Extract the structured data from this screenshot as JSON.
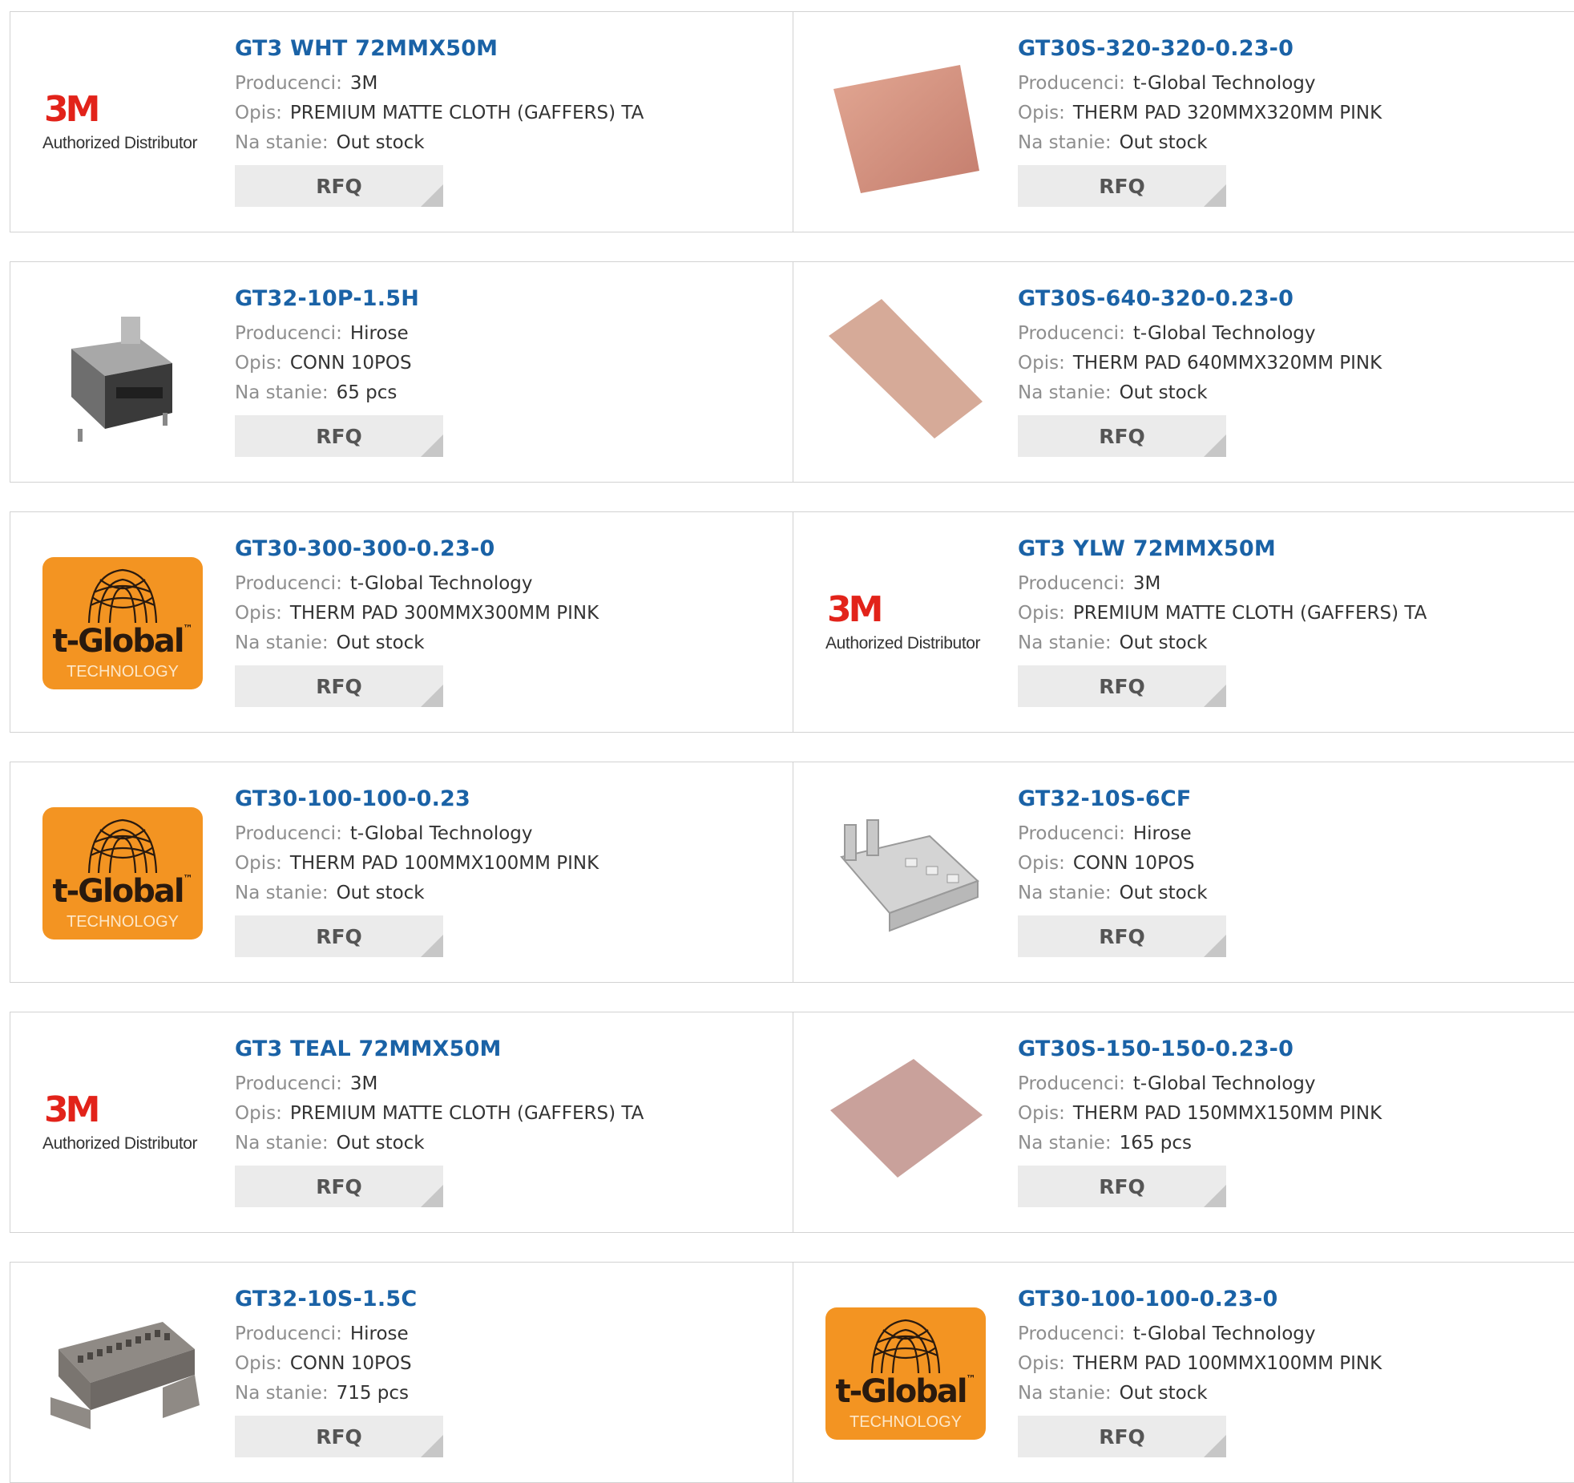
{
  "labels": {
    "manufacturer": "Producenci:",
    "description": "Opis:",
    "stock": "Na stanie:",
    "rfq": "RFQ"
  },
  "logos": {
    "three_m": {
      "mark": "3M",
      "sub": "Authorized Distributor"
    },
    "tglobal": {
      "word": "t-Global",
      "tm": "™",
      "tech": "TECHNOLOGY"
    }
  },
  "colors": {
    "link": "#1a62a6",
    "label": "#8e8e8e",
    "border": "#d2d2d2",
    "rfq_bg": "#ebebeb",
    "brand_3m": "#e2231a",
    "tglobal_orange": "#f39422"
  },
  "products": [
    {
      "part": "GT3 WHT 72MMX50M",
      "manufacturer": "3M",
      "description": "PREMIUM MATTE CLOTH (GAFFERS) TA",
      "stock": "Out stock",
      "image": "3m-logo"
    },
    {
      "part": "GT30S-320-320-0.23-0",
      "manufacturer": "t-Global Technology",
      "description": "THERM PAD 320MMX320MM PINK",
      "stock": "Out stock",
      "image": "thermal-pad-square"
    },
    {
      "part": "GT32-10P-1.5H",
      "manufacturer": "Hirose",
      "description": "CONN 10POS",
      "stock": "65 pcs",
      "image": "connector-header"
    },
    {
      "part": "GT30S-640-320-0.23-0",
      "manufacturer": "t-Global Technology",
      "description": "THERM PAD 640MMX320MM PINK",
      "stock": "Out stock",
      "image": "thermal-pad-rect"
    },
    {
      "part": "GT30-300-300-0.23-0",
      "manufacturer": "t-Global Technology",
      "description": "THERM PAD 300MMX300MM PINK",
      "stock": "Out stock",
      "image": "tglobal-logo"
    },
    {
      "part": "GT3 YLW 72MMX50M",
      "manufacturer": "3M",
      "description": "PREMIUM MATTE CLOTH (GAFFERS) TA",
      "stock": "Out stock",
      "image": "3m-logo"
    },
    {
      "part": "GT30-100-100-0.23",
      "manufacturer": "t-Global Technology",
      "description": "THERM PAD 100MMX100MM PINK",
      "stock": "Out stock",
      "image": "tglobal-logo"
    },
    {
      "part": "GT32-10S-6CF",
      "manufacturer": "Hirose",
      "description": "CONN 10POS",
      "stock": "Out stock",
      "image": "metal-shell"
    },
    {
      "part": "GT3 TEAL 72MMX50M",
      "manufacturer": "3M",
      "description": "PREMIUM MATTE CLOTH (GAFFERS) TA",
      "stock": "Out stock",
      "image": "3m-logo"
    },
    {
      "part": "GT30S-150-150-0.23-0",
      "manufacturer": "t-Global Technology",
      "description": "THERM PAD 150MMX150MM PINK",
      "stock": "165 pcs",
      "image": "thermal-pad-square-light"
    },
    {
      "part": "GT32-10S-1.5C",
      "manufacturer": "Hirose",
      "description": "CONN 10POS",
      "stock": "715 pcs",
      "image": "connector-housing"
    },
    {
      "part": "GT30-100-100-0.23-0",
      "manufacturer": "t-Global Technology",
      "description": "THERM PAD 100MMX100MM PINK",
      "stock": "Out stock",
      "image": "tglobal-logo"
    }
  ]
}
